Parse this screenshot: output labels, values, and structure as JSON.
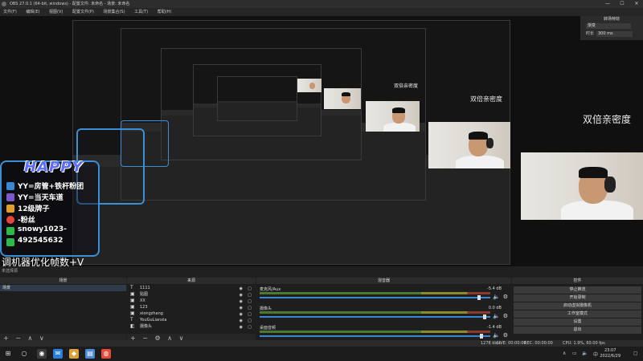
{
  "window": {
    "title": "OBS 27.0.1 (64-bit, windows) - 配置文件: 未命名 - 场景: 未命名",
    "minimize": "—",
    "maximize": "☐",
    "close": "✕"
  },
  "menu": [
    "文件(F)",
    "编辑(E)",
    "视图(V)",
    "配置文件(P)",
    "场景集合(S)",
    "工具(T)",
    "帮助(H)"
  ],
  "preview": {
    "overlay": {
      "logo_text": "HAPPY",
      "lines": [
        "YY=房管+铁杆粉团",
        "YY=当天车道",
        "12级牌子",
        "-粉丝",
        "snowy1023-",
        "492545632"
      ],
      "icon_colors": [
        "#3b86d1",
        "#7b59c9",
        "#e6463c",
        "#2fb84a",
        "#2fb84a",
        "#e0a02e"
      ]
    },
    "caption": "调机器优化帧数+V",
    "sub_caption": "未选择源",
    "dual_text": "双倍亲密度"
  },
  "transitions": {
    "header": "转场特效",
    "selected": "渐变",
    "duration_label": "时长",
    "duration_value": "300 ms"
  },
  "scenes": {
    "header": "场景",
    "items": [
      "场景"
    ],
    "footer": [
      "+",
      "−",
      "∧",
      "∨"
    ]
  },
  "sources": {
    "header": "来源",
    "items": [
      {
        "name": "1111",
        "icon": "text-icon"
      },
      {
        "name": "贴图",
        "icon": "image-icon"
      },
      {
        "name": "XX",
        "icon": "image-icon"
      },
      {
        "name": "123",
        "icon": "image-icon"
      },
      {
        "name": "xiongzhang",
        "icon": "image-icon"
      },
      {
        "name": "YouGuLianxia",
        "icon": "text-icon"
      },
      {
        "name": "摄像头",
        "icon": "camera-icon"
      }
    ],
    "footer": [
      "+",
      "−",
      "⚙",
      "∧",
      "∨"
    ]
  },
  "mixer": {
    "header": "混音器",
    "channels": [
      {
        "name": "麦克风/Aux",
        "db": "-5.4 dB",
        "level": 0.86
      },
      {
        "name": "摄像头",
        "db": "0.0 dB",
        "level": 0.78
      },
      {
        "name": "桌面音频",
        "db": "-1.4 dB",
        "level": 0.92
      }
    ]
  },
  "controls": {
    "header": "控件",
    "buttons": [
      "停止推流",
      "开始录制",
      "启动虚拟摄像机",
      "工作室模式",
      "设置",
      "退出"
    ]
  },
  "status": {
    "live": "LIVE: 00:00:00",
    "rec": "REC: 00:00:00",
    "cpu": "CPU: 1.9%, 60.00 fps",
    "kbps": "1278 kb/s"
  },
  "taskbar": {
    "time": "23:07",
    "date": "2022/6/29",
    "language": "中",
    "start": "⊞",
    "search": "○",
    "apps": [
      {
        "name": "obs-icon",
        "color": "#3a3a3a",
        "glyph": "◉"
      },
      {
        "name": "chat-icon",
        "color": "#2a7fd6",
        "glyph": "✉"
      },
      {
        "name": "game-icon",
        "color": "#d9a23a",
        "glyph": "◆"
      },
      {
        "name": "file-icon",
        "color": "#4a8bd4",
        "glyph": "▤"
      },
      {
        "name": "browser-icon",
        "color": "#e84a3a",
        "glyph": "◍"
      }
    ]
  }
}
